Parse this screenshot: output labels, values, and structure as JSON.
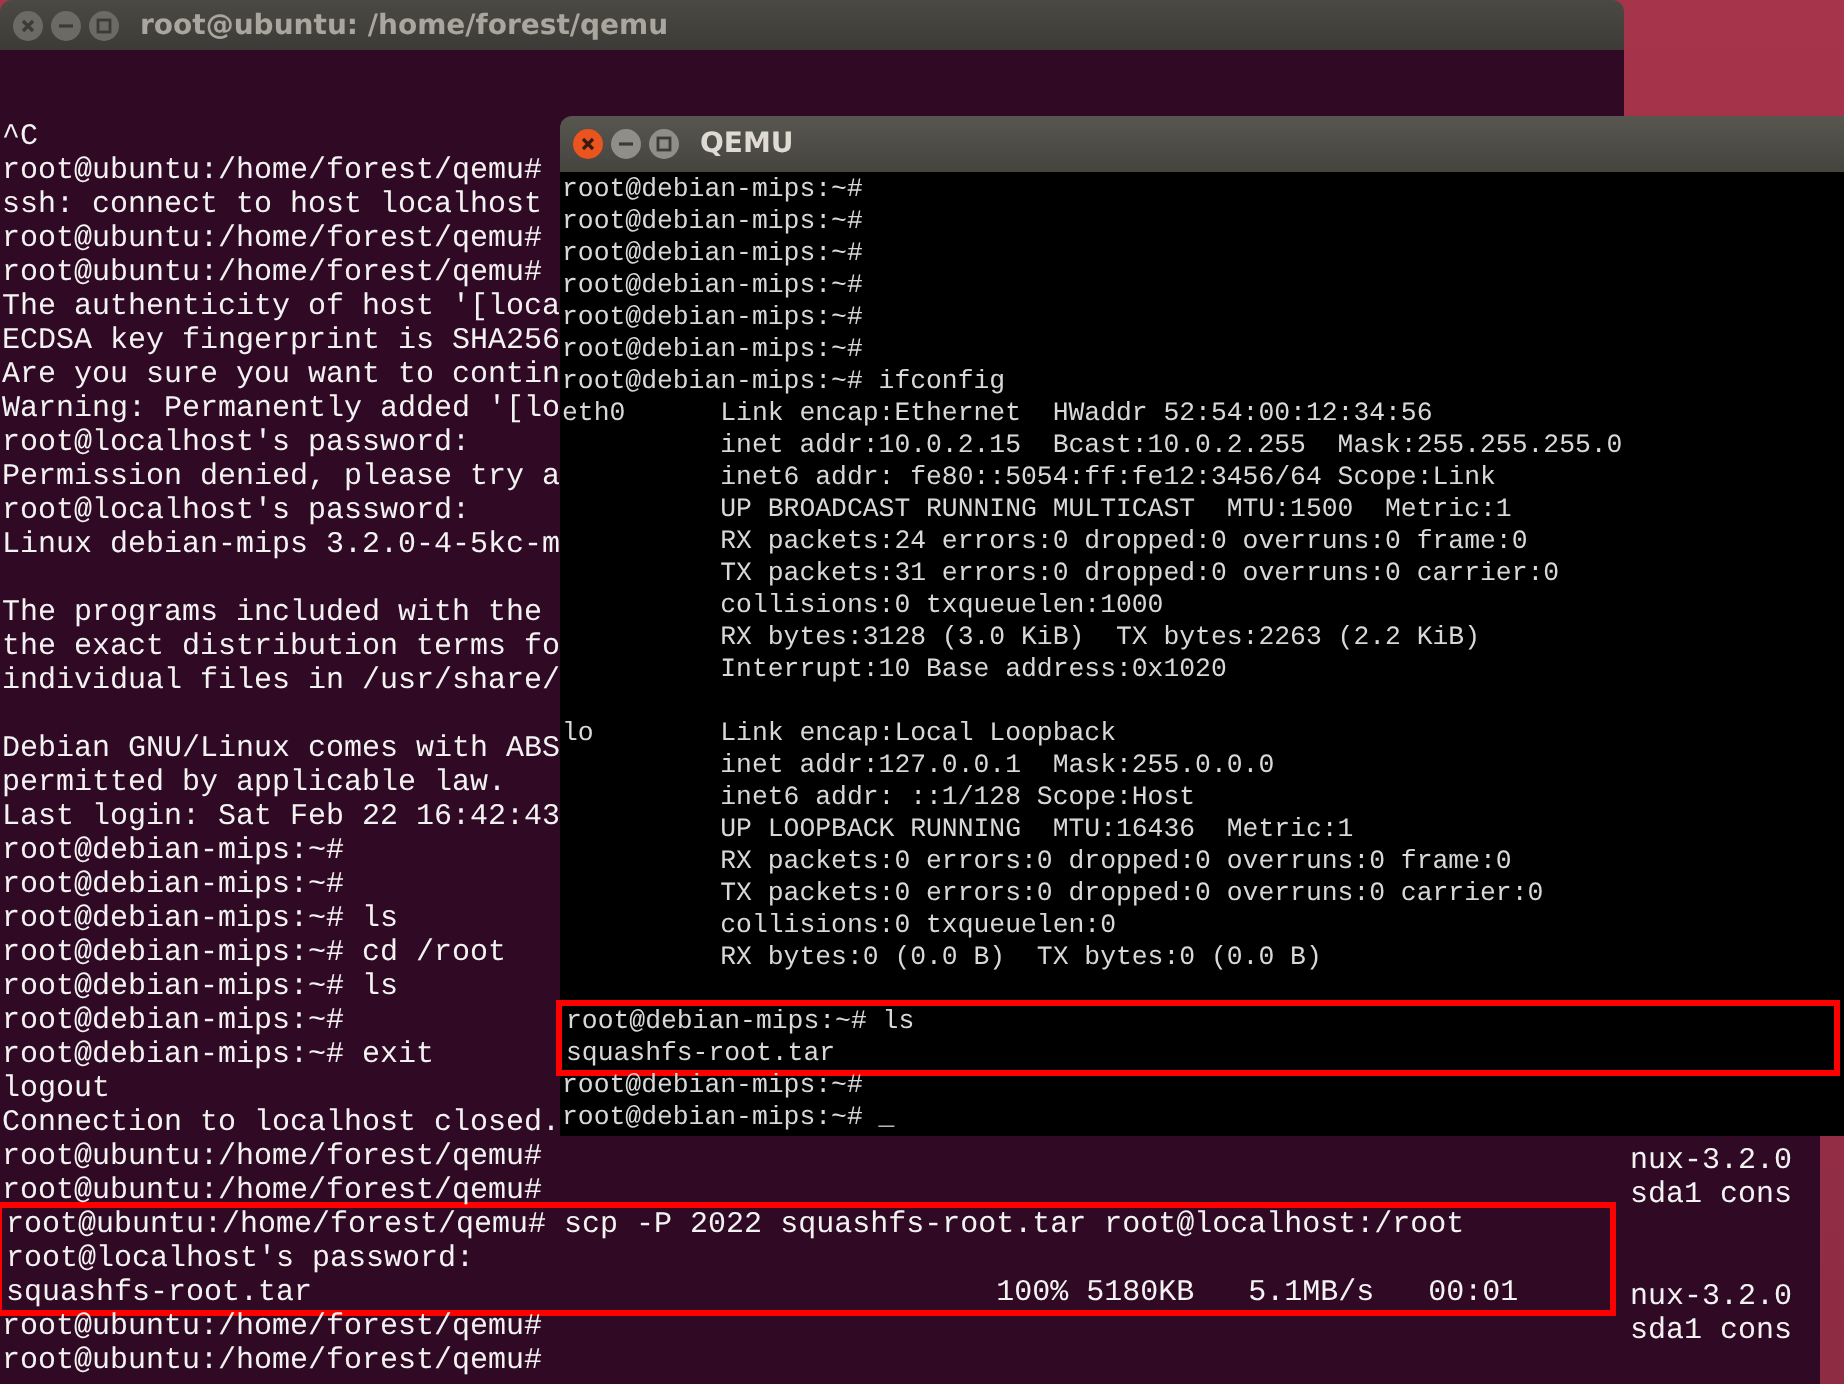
{
  "terminal_window": {
    "title": "root@ubuntu: /home/forest/qemu",
    "segments": [
      {
        "kind": "plain",
        "lines": [
          "^C",
          "root@ubuntu:/home/forest/qemu#",
          "ssh: connect to host localhost",
          "root@ubuntu:/home/forest/qemu#",
          "root@ubuntu:/home/forest/qemu#",
          "The authenticity of host '[loca",
          "ECDSA key fingerprint is SHA256",
          "Are you sure you want to contin",
          "Warning: Permanently added '[lo",
          "root@localhost's password:",
          "Permission denied, please try a",
          "root@localhost's password:",
          "Linux debian-mips 3.2.0-4-5kc-m"
        ]
      },
      {
        "kind": "gap"
      },
      {
        "kind": "plain",
        "lines": [
          "The programs included with the",
          "the exact distribution terms fo",
          "individual files in /usr/share/"
        ]
      },
      {
        "kind": "gap"
      },
      {
        "kind": "plain",
        "lines": [
          "Debian GNU/Linux comes with ABS",
          "permitted by applicable law.",
          "Last login: Sat Feb 22 16:42:43",
          "root@debian-mips:~#",
          "root@debian-mips:~#",
          "root@debian-mips:~# ls",
          "root@debian-mips:~# cd /root",
          "root@debian-mips:~# ls",
          "root@debian-mips:~#",
          "root@debian-mips:~# exit",
          "logout",
          "Connection to localhost closed.",
          "root@ubuntu:/home/forest/qemu#",
          "root@ubuntu:/home/forest/qemu#"
        ]
      },
      {
        "kind": "highlight",
        "lines": [
          "root@ubuntu:/home/forest/qemu# scp -P 2022 squashfs-root.tar root@localhost:/root",
          "root@localhost's password:",
          "squashfs-root.tar                                      100% 5180KB   5.1MB/s   00:01"
        ]
      },
      {
        "kind": "plain",
        "lines": [
          "root@ubuntu:/home/forest/qemu#",
          "root@ubuntu:/home/forest/qemu#"
        ]
      }
    ]
  },
  "qemu_window": {
    "title": "QEMU",
    "segments": [
      {
        "kind": "plain",
        "lines": [
          "root@debian-mips:~#",
          "root@debian-mips:~#",
          "root@debian-mips:~#",
          "root@debian-mips:~#",
          "root@debian-mips:~#",
          "root@debian-mips:~#",
          "root@debian-mips:~# ifconfig",
          "eth0      Link encap:Ethernet  HWaddr 52:54:00:12:34:56",
          "          inet addr:10.0.2.15  Bcast:10.0.2.255  Mask:255.255.255.0",
          "          inet6 addr: fe80::5054:ff:fe12:3456/64 Scope:Link",
          "          UP BROADCAST RUNNING MULTICAST  MTU:1500  Metric:1",
          "          RX packets:24 errors:0 dropped:0 overruns:0 frame:0",
          "          TX packets:31 errors:0 dropped:0 overruns:0 carrier:0",
          "          collisions:0 txqueuelen:1000",
          "          RX bytes:3128 (3.0 KiB)  TX bytes:2263 (2.2 KiB)",
          "          Interrupt:10 Base address:0x1020"
        ]
      },
      {
        "kind": "gap"
      },
      {
        "kind": "plain",
        "lines": [
          "lo        Link encap:Local Loopback",
          "          inet addr:127.0.0.1  Mask:255.0.0.0",
          "          inet6 addr: ::1/128 Scope:Host",
          "          UP LOOPBACK RUNNING  MTU:16436  Metric:1",
          "          RX packets:0 errors:0 dropped:0 overruns:0 frame:0",
          "          TX packets:0 errors:0 dropped:0 overruns:0 carrier:0",
          "          collisions:0 txqueuelen:0",
          "          RX bytes:0 (0.0 B)  TX bytes:0 (0.0 B)"
        ]
      },
      {
        "kind": "gap"
      },
      {
        "kind": "highlight",
        "lines": [
          "root@debian-mips:~# ls",
          "squashfs-root.tar"
        ]
      },
      {
        "kind": "plain",
        "lines": [
          "root@debian-mips:~#",
          "root@debian-mips:~# _"
        ]
      }
    ]
  },
  "background_terminal": {
    "segments": [
      {
        "kind": "plain",
        "lines": [
          "nux-3.2.0",
          "sda1 cons"
        ]
      },
      {
        "kind": "gap"
      },
      {
        "kind": "gap"
      },
      {
        "kind": "plain",
        "lines": [
          "nux-3.2.0",
          "sda1 cons"
        ]
      }
    ]
  }
}
